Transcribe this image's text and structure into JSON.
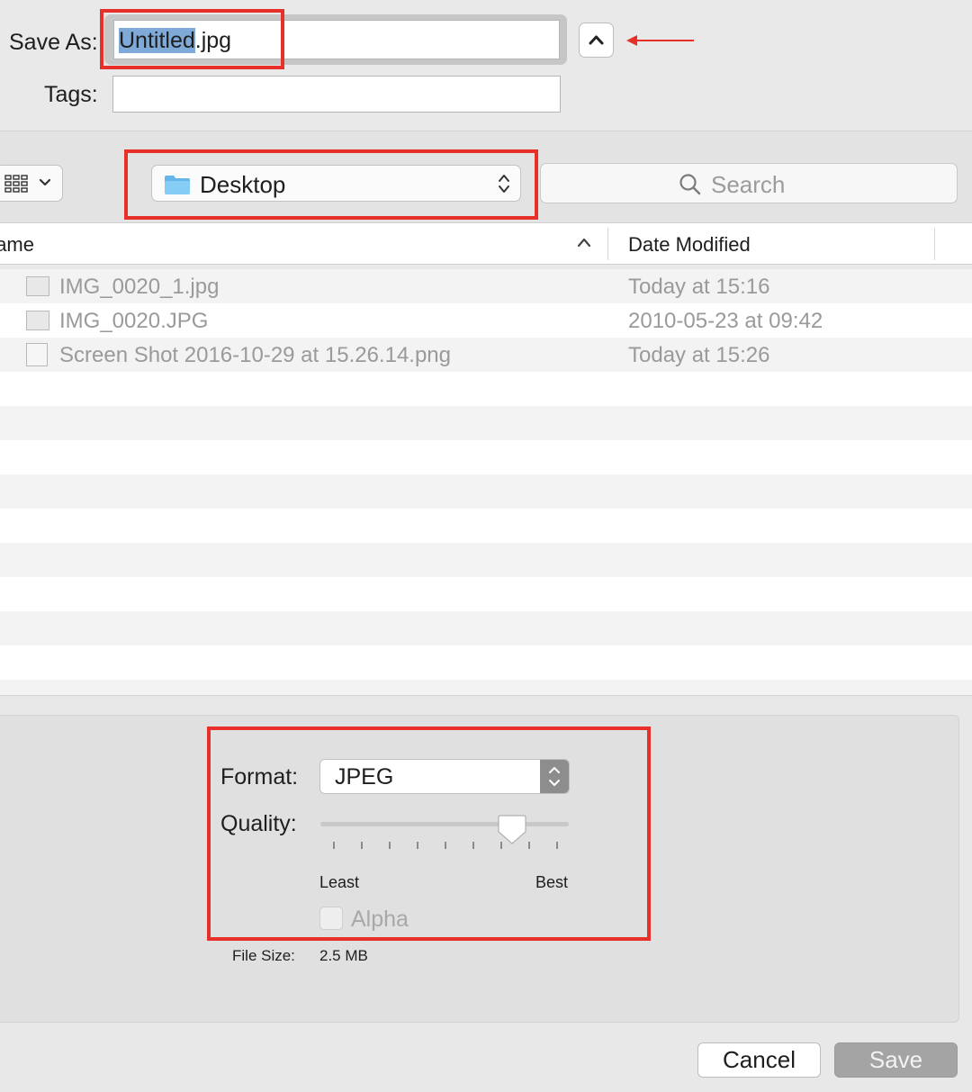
{
  "save_as": {
    "label": "Save As:",
    "filename_selected": "Untitled",
    "filename_ext": ".jpg"
  },
  "tags": {
    "label": "Tags:",
    "value": ""
  },
  "toolbar": {
    "location": "Desktop",
    "search_placeholder": "Search"
  },
  "list": {
    "columns": [
      "Name",
      "Date Modified"
    ],
    "files": [
      {
        "name": "IMG_0020_1.jpg",
        "date": "Today at 15:16"
      },
      {
        "name": "IMG_0020.JPG",
        "date": "2010-05-23 at 09:42"
      },
      {
        "name": "Screen Shot 2016-10-29 at 15.26.14.png",
        "date": "Today at 15:26"
      }
    ]
  },
  "options": {
    "format_label": "Format:",
    "format_value": "JPEG",
    "quality_label": "Quality:",
    "quality_min_label": "Least",
    "quality_max_label": "Best",
    "quality_level": 0.77,
    "alpha_label": "Alpha",
    "filesize_label": "File Size:",
    "filesize_value": "2.5 MB"
  },
  "buttons": {
    "cancel": "Cancel",
    "save": "Save"
  },
  "colors": {
    "annotation": "#e8302a",
    "selection": "#7fa9d8"
  }
}
